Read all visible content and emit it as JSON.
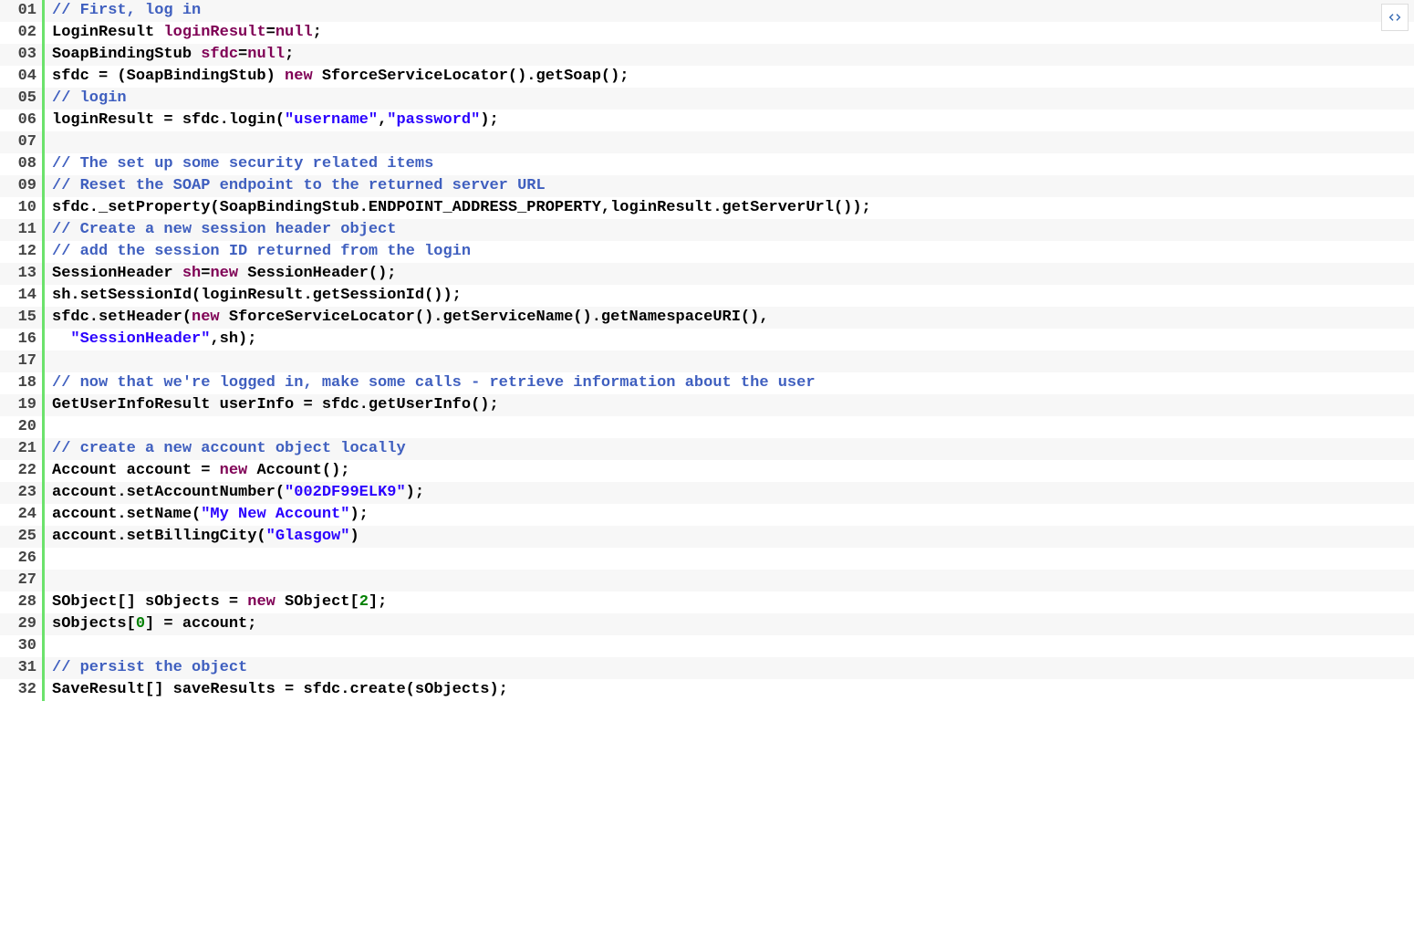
{
  "copy_button_title": "Copy",
  "lines": [
    {
      "n": "01",
      "tokens": [
        [
          "comment",
          "// First, log in"
        ]
      ]
    },
    {
      "n": "02",
      "tokens": [
        [
          "type",
          "LoginResult"
        ],
        [
          "plain",
          " "
        ],
        [
          "var",
          "loginResult"
        ],
        [
          "punct",
          "="
        ],
        [
          "keyword",
          "null"
        ],
        [
          "punct",
          ";"
        ]
      ]
    },
    {
      "n": "03",
      "tokens": [
        [
          "type",
          "SoapBindingStub"
        ],
        [
          "plain",
          " "
        ],
        [
          "var",
          "sfdc"
        ],
        [
          "punct",
          "="
        ],
        [
          "keyword",
          "null"
        ],
        [
          "punct",
          ";"
        ]
      ]
    },
    {
      "n": "04",
      "tokens": [
        [
          "plain",
          "sfdc = (SoapBindingStub) "
        ],
        [
          "keyword",
          "new"
        ],
        [
          "plain",
          " SforceServiceLocator().getSoap();"
        ]
      ]
    },
    {
      "n": "05",
      "tokens": [
        [
          "comment",
          "// login"
        ]
      ]
    },
    {
      "n": "06",
      "tokens": [
        [
          "plain",
          "loginResult = sfdc.login("
        ],
        [
          "string",
          "\"username\""
        ],
        [
          "punct",
          ","
        ],
        [
          "string",
          "\"password\""
        ],
        [
          "plain",
          ");"
        ]
      ]
    },
    {
      "n": "07",
      "tokens": [
        [
          "plain",
          ""
        ]
      ]
    },
    {
      "n": "08",
      "tokens": [
        [
          "comment",
          "// The set up some security related items"
        ]
      ]
    },
    {
      "n": "09",
      "tokens": [
        [
          "comment",
          "// Reset the SOAP endpoint to the returned server URL"
        ]
      ]
    },
    {
      "n": "10",
      "tokens": [
        [
          "plain",
          "sfdc._setProperty(SoapBindingStub.ENDPOINT_ADDRESS_PROPERTY,loginResult.getServerUrl());"
        ]
      ]
    },
    {
      "n": "11",
      "tokens": [
        [
          "comment",
          "// Create a new session header object"
        ]
      ]
    },
    {
      "n": "12",
      "tokens": [
        [
          "comment",
          "// add the session ID returned from the login"
        ]
      ]
    },
    {
      "n": "13",
      "tokens": [
        [
          "type",
          "SessionHeader"
        ],
        [
          "plain",
          " "
        ],
        [
          "var",
          "sh"
        ],
        [
          "punct",
          "="
        ],
        [
          "keyword",
          "new"
        ],
        [
          "plain",
          " SessionHeader();"
        ]
      ]
    },
    {
      "n": "14",
      "tokens": [
        [
          "plain",
          "sh.setSessionId(loginResult.getSessionId());"
        ]
      ]
    },
    {
      "n": "15",
      "tokens": [
        [
          "plain",
          "sfdc.setHeader("
        ],
        [
          "keyword",
          "new"
        ],
        [
          "plain",
          " SforceServiceLocator().getServiceName().getNamespaceURI(),"
        ]
      ]
    },
    {
      "n": "16",
      "tokens": [
        [
          "plain",
          "  "
        ],
        [
          "string",
          "\"SessionHeader\""
        ],
        [
          "plain",
          ",sh);"
        ]
      ]
    },
    {
      "n": "17",
      "tokens": [
        [
          "plain",
          ""
        ]
      ]
    },
    {
      "n": "18",
      "tokens": [
        [
          "comment",
          "// now that we're logged in, make some calls - retrieve information about the user"
        ]
      ]
    },
    {
      "n": "19",
      "tokens": [
        [
          "type",
          "GetUserInfoResult"
        ],
        [
          "plain",
          " userInfo = sfdc.getUserInfo();"
        ]
      ]
    },
    {
      "n": "20",
      "tokens": [
        [
          "plain",
          ""
        ]
      ]
    },
    {
      "n": "21",
      "tokens": [
        [
          "comment",
          "// create a new account object locally"
        ]
      ]
    },
    {
      "n": "22",
      "tokens": [
        [
          "type",
          "Account"
        ],
        [
          "plain",
          " account = "
        ],
        [
          "keyword",
          "new"
        ],
        [
          "plain",
          " Account();"
        ]
      ]
    },
    {
      "n": "23",
      "tokens": [
        [
          "plain",
          "account.setAccountNumber("
        ],
        [
          "string",
          "\"002DF99ELK9\""
        ],
        [
          "plain",
          ");"
        ]
      ]
    },
    {
      "n": "24",
      "tokens": [
        [
          "plain",
          "account.setName("
        ],
        [
          "string",
          "\"My New Account\""
        ],
        [
          "plain",
          ");"
        ]
      ]
    },
    {
      "n": "25",
      "tokens": [
        [
          "plain",
          "account.setBillingCity("
        ],
        [
          "string",
          "\"Glasgow\""
        ],
        [
          "plain",
          ")"
        ]
      ]
    },
    {
      "n": "26",
      "tokens": [
        [
          "plain",
          ""
        ]
      ]
    },
    {
      "n": "27",
      "tokens": [
        [
          "plain",
          ""
        ]
      ]
    },
    {
      "n": "28",
      "tokens": [
        [
          "type",
          "SObject[]"
        ],
        [
          "plain",
          " sObjects = "
        ],
        [
          "keyword",
          "new"
        ],
        [
          "plain",
          " SObject["
        ],
        [
          "num",
          "2"
        ],
        [
          "plain",
          "];"
        ]
      ]
    },
    {
      "n": "29",
      "tokens": [
        [
          "plain",
          "sObjects["
        ],
        [
          "num",
          "0"
        ],
        [
          "plain",
          "] = account;"
        ]
      ]
    },
    {
      "n": "30",
      "tokens": [
        [
          "plain",
          ""
        ]
      ]
    },
    {
      "n": "31",
      "tokens": [
        [
          "comment",
          "// persist the object"
        ]
      ]
    },
    {
      "n": "32",
      "tokens": [
        [
          "type",
          "SaveResult[]"
        ],
        [
          "plain",
          " saveResults = sfdc.create(sObjects);"
        ]
      ]
    }
  ]
}
